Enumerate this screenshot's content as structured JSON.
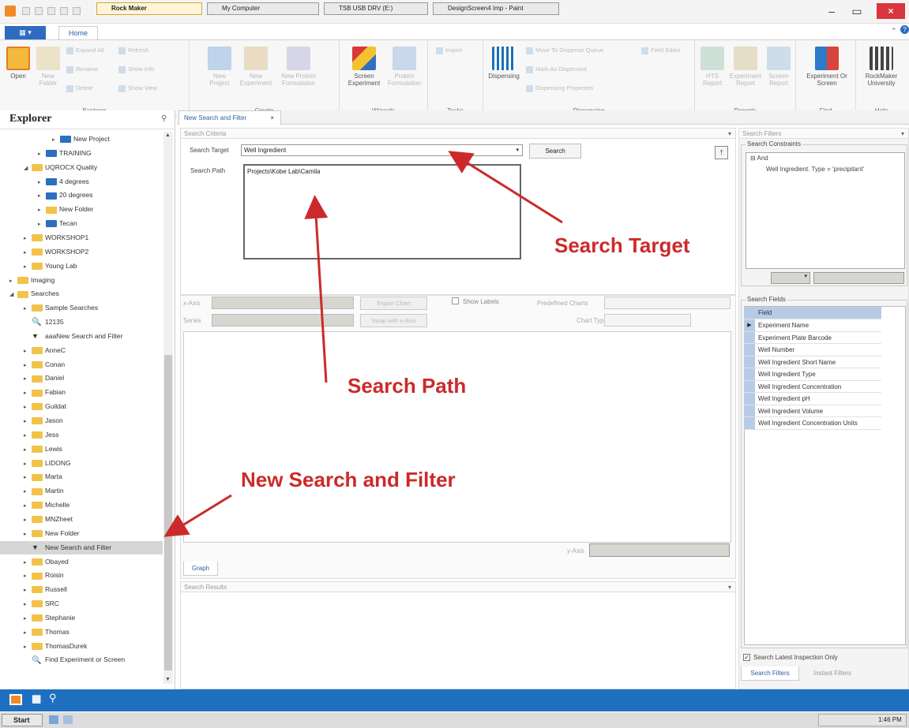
{
  "window": {
    "title": "Rock Maker",
    "minimize": "–",
    "restore": "▭",
    "close": "×"
  },
  "ribbon": {
    "file_tab": "▦ ▾",
    "home_tab": "Home",
    "groups": {
      "explorer": "Explorer",
      "create": "Create",
      "wizards": "Wizards",
      "tasks": "Tasks",
      "dispensing": "Dispensing",
      "reports": "Reports",
      "find": "Find",
      "help": "Help"
    },
    "buttons": {
      "open": "Open",
      "new_folder": "New Folder",
      "new_project": "New Project",
      "new_experiment": "New Experiment",
      "new_protein_formulation": "New Protein Formulation",
      "screen_experiment": "Screen Experiment",
      "protein_formulation": "Protein Formulation",
      "import": "Import",
      "dispensing": "Dispensing",
      "move_to_dispense_queue": "Move To Dispense Queue",
      "field_editor": "Field Editor",
      "mark_as_dispensed": "Mark As Dispensed",
      "dispensing_properties": "Dispensing Properties",
      "hts_report": "HTS Report",
      "experiment_report": "Experiment Report",
      "screen_report": "Screen Report",
      "experiment_or_screen": "Experiment Or Screen",
      "rockmaker_university": "RockMaker University",
      "expand_all": "Expand All",
      "refresh": "Refresh",
      "rename": "Rename",
      "show_info": "Show Info",
      "delete": "Delete",
      "show_view": "Show View"
    }
  },
  "explorer": {
    "title": "Explorer",
    "pin": "⚲",
    "items": [
      {
        "label": "New Project",
        "indent": 3,
        "color": "blue",
        "expander": "▸"
      },
      {
        "label": "TRAINING",
        "indent": 2,
        "color": "blue",
        "expander": "▸"
      },
      {
        "label": "UQROCX Quality",
        "indent": 1,
        "color": "yellow",
        "expander": "◢"
      },
      {
        "label": "4 degrees",
        "indent": 2,
        "color": "blue",
        "expander": "▸"
      },
      {
        "label": "20 degrees",
        "indent": 2,
        "color": "blue",
        "expander": "▸"
      },
      {
        "label": "New Folder",
        "indent": 2,
        "color": "yellow",
        "expander": "▸"
      },
      {
        "label": "Tecan",
        "indent": 2,
        "color": "blue",
        "expander": "▸"
      },
      {
        "label": "WORKSHOP1",
        "indent": 1,
        "color": "yellow",
        "expander": "▸"
      },
      {
        "label": "WORKSHOP2",
        "indent": 1,
        "color": "yellow",
        "expander": "▸"
      },
      {
        "label": "Young Lab",
        "indent": 1,
        "color": "yellow",
        "expander": "▸"
      },
      {
        "label": "Imaging",
        "indent": 0,
        "color": "yellow",
        "expander": "▸"
      },
      {
        "label": "Searches",
        "indent": 0,
        "color": "yellow",
        "expander": "◢"
      },
      {
        "label": "Sample Searches",
        "indent": 1,
        "color": "yellow",
        "expander": "▸"
      },
      {
        "label": "12135",
        "indent": 1,
        "color": "search",
        "expander": ""
      },
      {
        "label": "aaaNew Search and Filter",
        "indent": 1,
        "color": "filter",
        "expander": ""
      },
      {
        "label": "AnneC",
        "indent": 1,
        "color": "yellow",
        "expander": "▸"
      },
      {
        "label": "Conan",
        "indent": 1,
        "color": "yellow",
        "expander": "▸"
      },
      {
        "label": "Daniel",
        "indent": 1,
        "color": "yellow",
        "expander": "▸"
      },
      {
        "label": "Fabian",
        "indent": 1,
        "color": "yellow",
        "expander": "▸"
      },
      {
        "label": "Guildat",
        "indent": 1,
        "color": "yellow",
        "expander": "▸"
      },
      {
        "label": "Jason",
        "indent": 1,
        "color": "yellow",
        "expander": "▸"
      },
      {
        "label": "Jess",
        "indent": 1,
        "color": "yellow",
        "expander": "▸"
      },
      {
        "label": "Lewis",
        "indent": 1,
        "color": "yellow",
        "expander": "▸"
      },
      {
        "label": "LIDONG",
        "indent": 1,
        "color": "yellow",
        "expander": "▸"
      },
      {
        "label": "Marta",
        "indent": 1,
        "color": "yellow",
        "expander": "▸"
      },
      {
        "label": "Martin",
        "indent": 1,
        "color": "yellow",
        "expander": "▸"
      },
      {
        "label": "Michelle",
        "indent": 1,
        "color": "yellow",
        "expander": "▸"
      },
      {
        "label": "MNZheet",
        "indent": 1,
        "color": "yellow",
        "expander": "▸"
      },
      {
        "label": "New Folder",
        "indent": 1,
        "color": "yellow",
        "expander": "▸"
      },
      {
        "label": "New Search and Filter",
        "indent": 1,
        "color": "filter",
        "expander": "",
        "selected": true
      },
      {
        "label": "Obayed",
        "indent": 1,
        "color": "yellow",
        "expander": "▸"
      },
      {
        "label": "Roisin",
        "indent": 1,
        "color": "yellow",
        "expander": "▸"
      },
      {
        "label": "Russell",
        "indent": 1,
        "color": "yellow",
        "expander": "▸"
      },
      {
        "label": "SRC",
        "indent": 1,
        "color": "yellow",
        "expander": "▸"
      },
      {
        "label": "Stephanie",
        "indent": 1,
        "color": "yellow",
        "expander": "▸"
      },
      {
        "label": "Thomas",
        "indent": 1,
        "color": "yellow",
        "expander": "▸"
      },
      {
        "label": "ThomasDurek",
        "indent": 1,
        "color": "yellow",
        "expander": "▸"
      },
      {
        "label": "Find Experiment or Screen",
        "indent": 1,
        "color": "search",
        "expander": ""
      }
    ]
  },
  "document_tab": {
    "label": "New Search and Filter",
    "close": "×"
  },
  "search_criteria": {
    "header": "Search Criteria",
    "target_label": "Search Target",
    "target_value": "Well Ingredient",
    "search_button": "Search",
    "path_label": "Search Path",
    "path_value": "Projects\\Kobe Lab\\Camila",
    "up_button": "↑"
  },
  "chart_area": {
    "x_axis_label": "x-Axis",
    "series_label": "Series",
    "export_chart": "Export Chart",
    "swap_axis": "Swap with x-Axis",
    "show_labels": "Show Labels",
    "predefined_charts": "Predefined Charts",
    "chart_type": "Chart Type",
    "y_axis_label": "y-Axis",
    "graph_tab": "Graph"
  },
  "search_results": {
    "header": "Search Results"
  },
  "search_filters": {
    "header": "Search Filters",
    "constraints_label": "Search Constraints",
    "constraint_root": "And",
    "constraint_item": "Well Ingredient. Type = 'precipitant'",
    "fields_label": "Search Fields",
    "fields_header": "Field",
    "fields": [
      "Experiment Name",
      "Experiment Plate Barcode",
      "Well Number",
      "Well Ingredient Short Name",
      "Well Ingredient Type",
      "Well Ingredient Concentration",
      "Well Ingredient pH",
      "Well Ingredient Volume",
      "Well Ingredient Concentration Units"
    ],
    "latest_inspection": "Search Latest Inspection Only",
    "tab_search_filters": "Search Filters",
    "tab_instant_filters": "Instant Filters"
  },
  "annotations": {
    "search_target": "Search Target",
    "search_path": "Search Path",
    "new_search": "New Search and Filter"
  },
  "annotation_color": "#cc2a2a",
  "taskbar": {
    "start": "Start",
    "items": [
      "Rock Maker",
      "My Computer",
      "TSB USB DRV (E:)",
      "DesignScreen4 Imp - Paint"
    ],
    "clock": "1:46 PM"
  }
}
